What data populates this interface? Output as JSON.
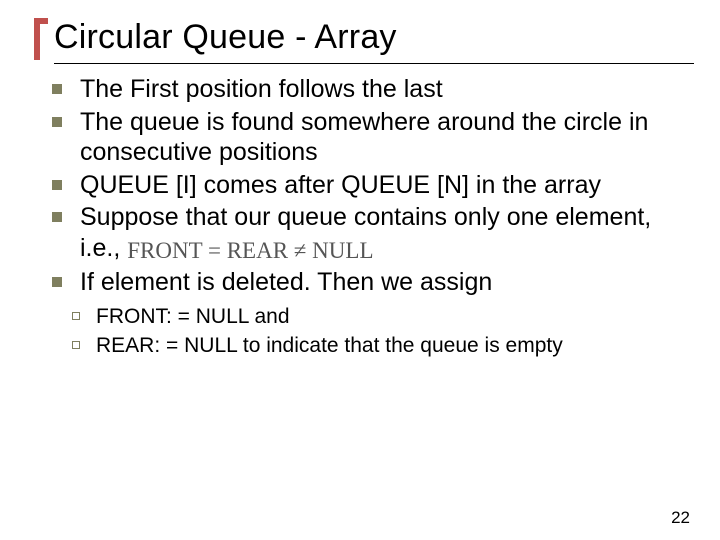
{
  "title": "Circular Queue - Array",
  "bullets": {
    "b1": "The First position follows the last",
    "b2": "The queue is found somewhere around the circle in consecutive positions",
    "b3": "QUEUE [I] comes after QUEUE [N] in the array",
    "b4_pre": "Suppose that our queue contains only one element, i.e., ",
    "b5": "If element is deleted. Then we assign"
  },
  "formula": {
    "text": "FRONT = REAR ≠ NULL"
  },
  "sub": {
    "s1": "FRONT: = NULL and",
    "s2": "REAR: = NULL to indicate that the queue is empty"
  },
  "page": "22"
}
